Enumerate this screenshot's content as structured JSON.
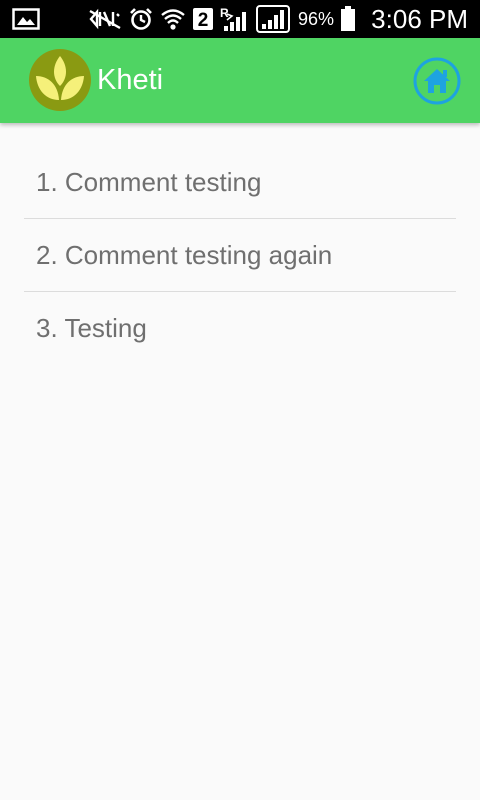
{
  "status_bar": {
    "battery_percent": "96%",
    "time": "3:06 PM",
    "sim_indicator": "2",
    "roaming_indicator": "R",
    "icons": [
      "gallery-icon",
      "nfc-off-icon",
      "alarm-icon",
      "wifi-icon",
      "sim-2-icon",
      "signal-roaming-icon",
      "signal-icon",
      "battery-icon"
    ]
  },
  "app_bar": {
    "title": "Kheti",
    "logo_icon": "leaf-logo-icon",
    "home_icon": "home-icon",
    "colors": {
      "bar": "#4fd463",
      "logo_circle": "#8a9a12",
      "logo_leaf": "#f5f07a",
      "home": "#1ea3e0"
    }
  },
  "comments": [
    {
      "text": "1. Comment testing"
    },
    {
      "text": "2. Comment testing again"
    },
    {
      "text": "3. Testing"
    }
  ]
}
